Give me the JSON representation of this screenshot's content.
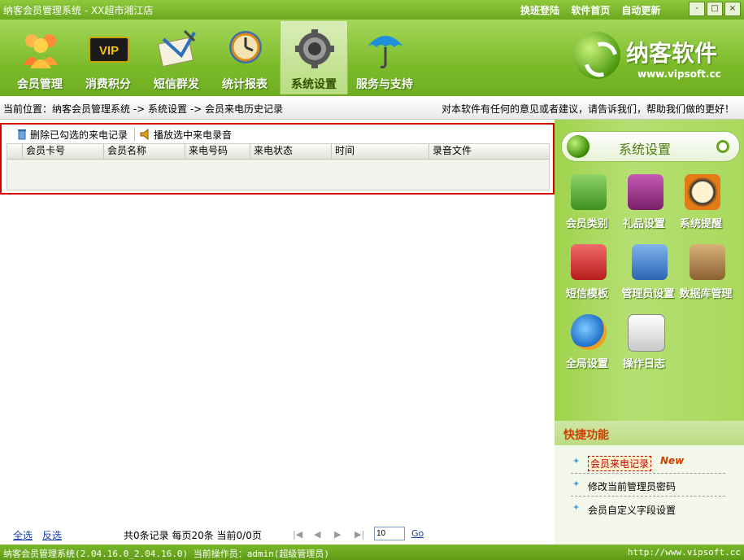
{
  "app": {
    "title": "纳客会员管理系统 - XX超市湘江店",
    "top_links": [
      "换班登陆",
      "软件首页",
      "自动更新"
    ],
    "window_buttons": [
      "-",
      "□",
      "×"
    ]
  },
  "nav": {
    "items": [
      {
        "label": "会员管理",
        "icon": "members-icon"
      },
      {
        "label": "消费积分",
        "icon": "vip-card-icon"
      },
      {
        "label": "短信群发",
        "icon": "sms-letter-icon"
      },
      {
        "label": "统计报表",
        "icon": "clock-report-icon"
      },
      {
        "label": "系统设置",
        "icon": "gear-settings-icon",
        "active": true
      },
      {
        "label": "服务与支持",
        "icon": "umbrella-icon"
      }
    ]
  },
  "brand": {
    "name": "纳客软件",
    "url": "www.vipsoft.cc"
  },
  "breadcrumb": {
    "text": "当前位置：纳客会员管理系统 -> 系统设置 -> 会员来电历史记录",
    "feedback": "对本软件有任何的意见或者建议，请告诉我们，帮助我们做的更好！"
  },
  "actions": {
    "delete_label": "删除已勾选的来电记录",
    "play_label": "播放选中来电录音"
  },
  "table": {
    "columns": [
      "会员卡号",
      "会员名称",
      "来电号码",
      "来电状态",
      "时间",
      "录音文件"
    ],
    "rows": []
  },
  "pager": {
    "select_all": "全选",
    "invert": "反选",
    "info": "共0条记录  每页20条  当前0/0页",
    "page_input": "10",
    "go": "Go"
  },
  "sidebar": {
    "title": "系统设置",
    "tiles": [
      {
        "label": "会员类别",
        "icon": "member-category-icon",
        "color": "#5aa832"
      },
      {
        "label": "礼品设置",
        "icon": "gift-settings-icon",
        "color": "#9b2f8a"
      },
      {
        "label": "系统提醒",
        "icon": "system-reminder-icon",
        "color": "#e47a16"
      },
      {
        "label": "短信模板",
        "icon": "sms-template-icon",
        "color": "#d83030"
      },
      {
        "label": "管理员设置",
        "icon": "admin-settings-icon",
        "color": "#3a78c8"
      },
      {
        "label": "数据库管理",
        "icon": "database-icon",
        "color": "#3f8f3a"
      },
      {
        "label": "全局设置",
        "icon": "global-settings-icon",
        "color": "#1e70c8"
      },
      {
        "label": "操作日志",
        "icon": "operation-log-icon",
        "color": "#d9d9d9"
      }
    ]
  },
  "quick": {
    "title": "快捷功能",
    "items": [
      {
        "label": "会员来电记录",
        "highlight": true,
        "badge": "New"
      },
      {
        "label": "修改当前管理员密码"
      },
      {
        "label": "会员自定义字段设置"
      }
    ]
  },
  "status": {
    "left": "纳客会员管理系统(2.04.16.0_2.04.16.0)  当前操作员：admin(超级管理员)",
    "right": "http://www.vipsoft.cc"
  }
}
